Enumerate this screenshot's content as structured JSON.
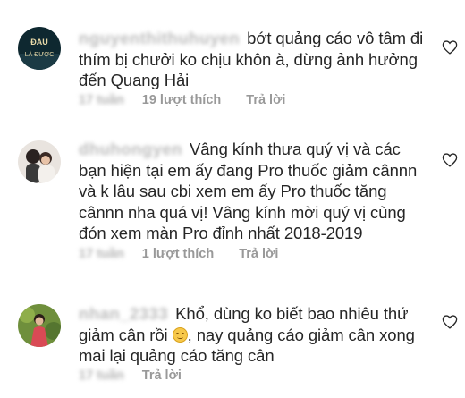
{
  "comments": [
    {
      "username": "nguyenthithuhuyen",
      "text": "bớt quảng cáo vô tâm đi thím bị chưởi ko chịu khôn à, đừng ảnh hưởng đến Quang Hải",
      "time": "17 tuần",
      "likes": "19 lượt thích",
      "reply": "Trả lời",
      "avatar_text_top": "ĐAU",
      "avatar_text_bottom": "LÀ ĐƯỢC"
    },
    {
      "username": "dhuhongyen",
      "text": "Vâng kính thưa quý vị và các bạn hiện tại em ấy đang Pro thuốc giảm cânnn và k lâu sau cbi xem em ấy Pro thuốc tăng cânnn nha quá vị! Vâng kính mời quý vị cùng đón xem màn Pro đỉnh nhất 2018-2019",
      "time": "17 tuần",
      "likes": "1 lượt thích",
      "reply": "Trả lời"
    },
    {
      "username": "nhan_2333",
      "text_before_emoji": "Khổ, dùng ko biết bao nhiêu thứ giảm cân rồi",
      "text_after_emoji": ", nay quảng cáo giảm cân xong mai lại quảng cáo tăng cân",
      "emoji": "smiling-face-icon",
      "time": "17 tuần",
      "reply": "Trả lời"
    }
  ],
  "colors": {
    "text": "#262626",
    "meta": "#999999",
    "heart": "#262626"
  }
}
